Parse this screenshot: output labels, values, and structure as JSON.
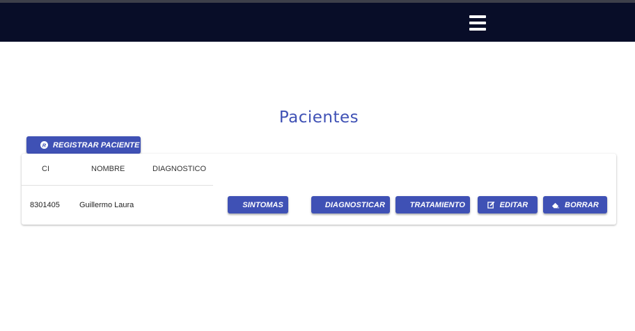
{
  "navbar": {
    "menu_icon": "hamburger-menu-icon"
  },
  "page": {
    "title": "Pacientes"
  },
  "toolbar": {
    "register_label": "REGISTRAR PACIENTE",
    "register_icon": "registered-icon"
  },
  "table": {
    "columns": [
      "CI",
      "NOMBRE",
      "DIAGNOSTICO"
    ],
    "rows": [
      {
        "ci": "8301405",
        "nombre": "Guillermo Laura",
        "diagnostico": "",
        "actions": {
          "sintomas": "SINTOMAS",
          "diagnosticar": "DIAGNOSTICAR",
          "tratamiento": "TRATAMIENTO",
          "editar": "EDITAR",
          "borrar": "BORRAR"
        }
      }
    ]
  },
  "colors": {
    "primary": "#3f51b5",
    "navbar": "#080d28",
    "title": "#3f51b5"
  }
}
